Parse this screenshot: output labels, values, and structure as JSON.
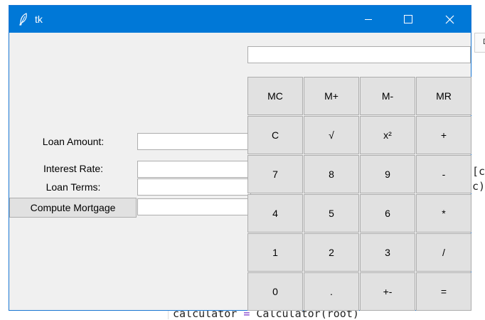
{
  "window": {
    "title": "tk"
  },
  "mortgage": {
    "loan_amount_label": "Loan Amount:",
    "interest_rate_label": "Interest Rate:",
    "loan_terms_label": "Loan Terms:",
    "compute_button": "Compute Mortgage",
    "loan_amount_value": "",
    "interest_rate_value": "",
    "loan_terms_value": "",
    "result_value": ""
  },
  "calculator": {
    "display_value": "",
    "keys": [
      [
        "MC",
        "M+",
        "M-",
        "MR"
      ],
      [
        "C",
        "√",
        "x²",
        "+"
      ],
      [
        "7",
        "8",
        "9",
        "-"
      ],
      [
        "4",
        "5",
        "6",
        "*"
      ],
      [
        "1",
        "2",
        "3",
        "/"
      ],
      [
        "0",
        ".",
        "+-",
        "="
      ]
    ]
  },
  "background": {
    "right_box_text": "D",
    "code_right_1": "[c",
    "code_right_2": "c)",
    "code_bottom_var": "calculator",
    "code_bottom_op": "=",
    "code_bottom_call": "Calculator(root)"
  },
  "colors": {
    "titlebar": "#0078d7",
    "window_bg": "#f0f0f0",
    "button_bg": "#e1e1e1"
  }
}
